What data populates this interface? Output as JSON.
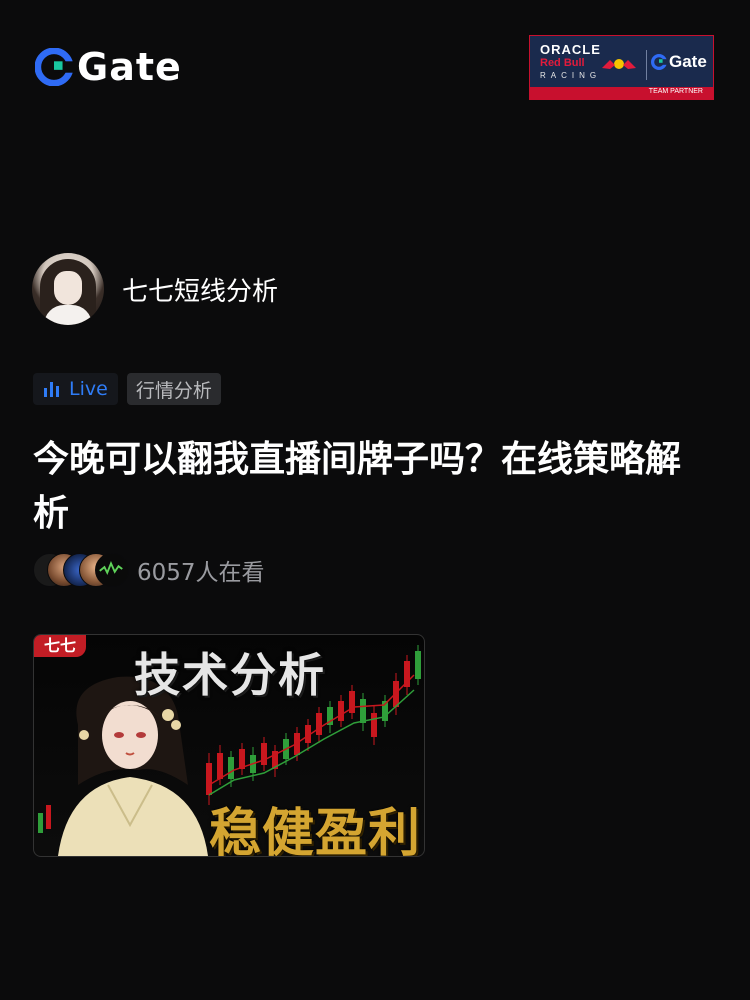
{
  "header": {
    "logo_text": "Gate",
    "logo_color": "#2f6bf5",
    "accent_color": "#19c7a0"
  },
  "partner_badge": {
    "oracle": "ORACLE",
    "redbull": "Red Bull",
    "racing": "RACING",
    "brand": "Gate",
    "tagline": "TEAM PARTNER"
  },
  "author": {
    "name": "七七短线分析"
  },
  "tags": {
    "live_label": "Live",
    "category_label": "行情分析",
    "live_color": "#2f7cf6"
  },
  "post": {
    "title": "今晚可以翻我直播间牌子吗？在线策略解析",
    "viewer_count": "6057人在看"
  },
  "thumbnail": {
    "badge": "七七",
    "headline": "技术分析",
    "slogan": "稳健盈利"
  }
}
